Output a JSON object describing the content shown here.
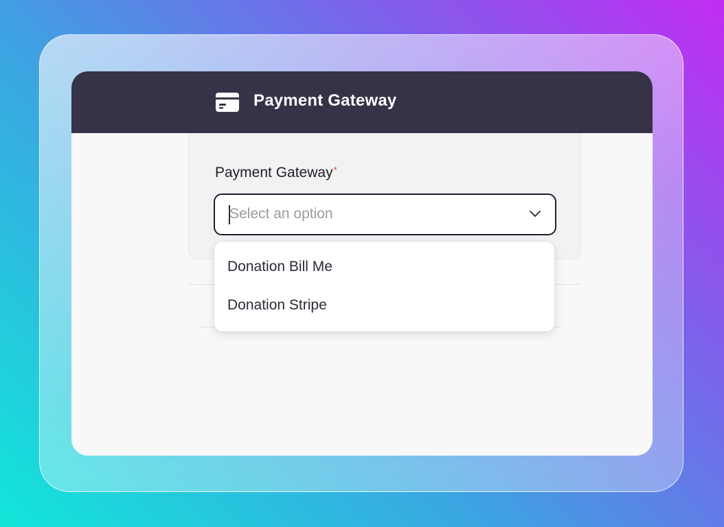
{
  "header": {
    "title": "Payment Gateway",
    "icon": "credit-card-icon"
  },
  "form": {
    "field_label": "Payment Gateway",
    "required_marker": "*",
    "select": {
      "placeholder": "Select an option",
      "value": "",
      "chevron_icon": "chevron-down-icon"
    }
  },
  "dropdown": {
    "options": [
      {
        "label": "Donation Bill Me"
      },
      {
        "label": "Donation Stripe"
      }
    ]
  },
  "colors": {
    "header_bg": "#363247",
    "select_border": "#1f1d30",
    "required": "#e3342f"
  }
}
